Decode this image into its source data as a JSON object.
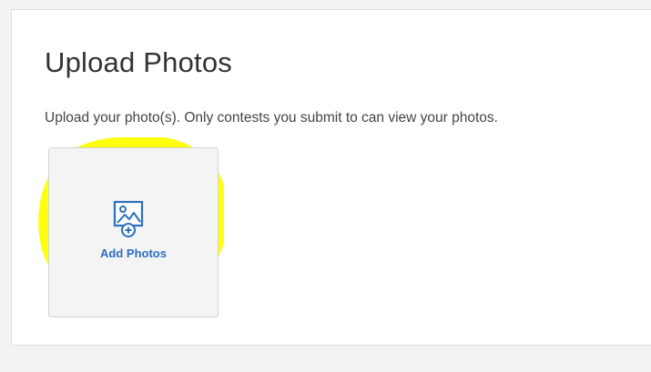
{
  "upload_section": {
    "title": "Upload Photos",
    "description": "Upload your photo(s). Only contests you submit to can view your photos.",
    "add_tile": {
      "label": "Add Photos",
      "icon": "add-photo-icon"
    }
  },
  "annotation": {
    "highlight_color": "#ffff00"
  },
  "colors": {
    "accent": "#2c6fbf",
    "title_text": "#333333",
    "body_text": "#444444"
  }
}
